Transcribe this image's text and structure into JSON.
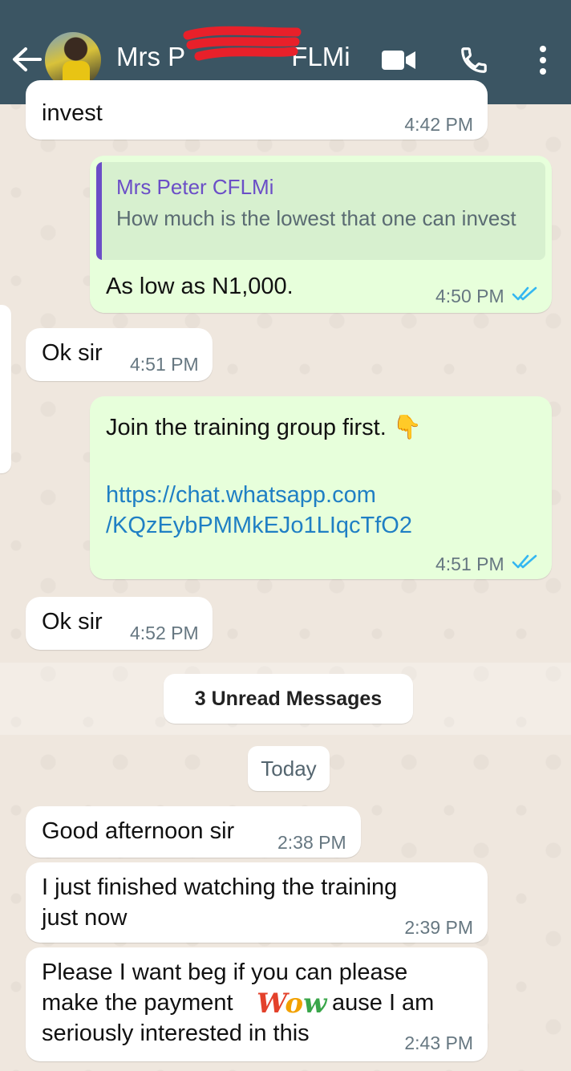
{
  "header": {
    "contact_name": "Mrs P                    FLMi",
    "accent_color": "#3b5563",
    "icons": [
      "back-arrow-icon",
      "avatar",
      "video-call-icon",
      "voice-call-icon",
      "more-options-icon"
    ]
  },
  "messages": [
    {
      "id": "m1",
      "dir": "in",
      "text": "invest",
      "time": "4:42 PM"
    },
    {
      "id": "m2",
      "dir": "out",
      "quote_author": "Mrs Peter CFLMi",
      "quote_text": "How much is the lowest that one can invest",
      "text": "As low as N1,000.",
      "time": "4:50 PM",
      "status": "read"
    },
    {
      "id": "m3",
      "dir": "in",
      "text": "Ok sir",
      "time": "4:51 PM"
    },
    {
      "id": "m4",
      "dir": "out",
      "text": "Join the training group first. 👇",
      "link_line1": "https://chat.whatsapp.com",
      "link_line2": "/KQzEybPMMkEJo1LIqcTfO2",
      "time": "4:51 PM",
      "status": "read"
    },
    {
      "id": "m5",
      "dir": "in",
      "text": "Ok sir",
      "time": "4:52 PM"
    },
    {
      "id": "m6",
      "dir": "in",
      "text": "Good afternoon sir",
      "time": "2:38 PM"
    },
    {
      "id": "m7",
      "dir": "in",
      "line1": "I just finished watching the training",
      "line2": "just now",
      "time": "2:39 PM"
    },
    {
      "id": "m8",
      "dir": "in",
      "line1": "Please I want beg if you can please",
      "line2a": "make the payment",
      "line2b": "ause I am",
      "line3": "seriously interested in this",
      "time": "2:43 PM",
      "sticker_text": "Wow"
    }
  ],
  "dividers": {
    "unread": "3 Unread Messages",
    "date": "Today"
  },
  "colors": {
    "incoming": "#ffffff",
    "outgoing": "#e7ffdb",
    "link": "#1f7fc4",
    "read_ticks": "#34b7f1"
  }
}
